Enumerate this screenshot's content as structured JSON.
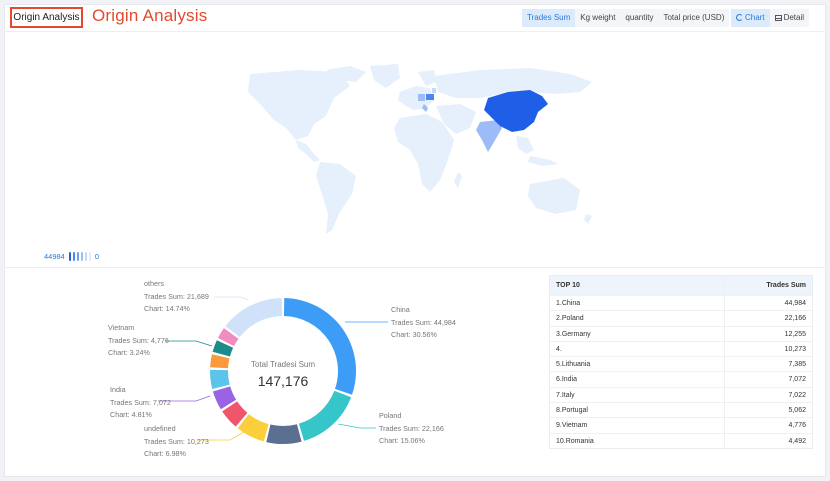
{
  "header": {
    "badge_title": "Origin Analysis",
    "big_title": "Origin Analysis",
    "metric_tabs": [
      "Trades Sum",
      "Kg weight",
      "quantity",
      "Total price (USD)"
    ],
    "active_metric": "Trades Sum",
    "view_tabs": [
      "Chart",
      "Detail"
    ],
    "active_view": "Chart"
  },
  "map_legend": {
    "max_label": "44984",
    "min_label": "0",
    "bar_colors": [
      "#1f5fe8",
      "#4d86ee",
      "#6f9ef2",
      "#9bbcf6",
      "#c4d8fa",
      "#e3edfc"
    ]
  },
  "donut": {
    "center_label": "Total Tradesi Sum",
    "center_value": "147,176",
    "labels": {
      "others": {
        "name": "others",
        "sum": "Trades Sum: 21,689",
        "pct": "Chart: 14.74%"
      },
      "vietnam": {
        "name": "Vietnam",
        "sum": "Trades Sum: 4,776",
        "pct": "Chart: 3.24%"
      },
      "india": {
        "name": "India",
        "sum": "Trades Sum: 7,072",
        "pct": "Chart: 4.81%"
      },
      "undefined": {
        "name": "undefined",
        "sum": "Trades Sum: 10,273",
        "pct": "Chart: 6.98%"
      },
      "china": {
        "name": "China",
        "sum": "Trades Sum: 44,984",
        "pct": "Chart: 30.56%"
      },
      "poland": {
        "name": "Poland",
        "sum": "Trades Sum: 22,166",
        "pct": "Chart: 15.06%"
      }
    }
  },
  "chart_data": {
    "type": "pie",
    "title": "",
    "total": 147176,
    "slices": [
      {
        "label": "China",
        "value": 44984,
        "color": "#3d9cf5"
      },
      {
        "label": "Poland",
        "value": 22166,
        "color": "#36c5c9"
      },
      {
        "label": "Germany",
        "value": 12255,
        "color": "#5b6f91"
      },
      {
        "label": "undefined",
        "value": 10273,
        "color": "#fbce3c"
      },
      {
        "label": "Lithuania",
        "value": 7385,
        "color": "#f0566b"
      },
      {
        "label": "India",
        "value": 7072,
        "color": "#9a63e3"
      },
      {
        "label": "Italy",
        "value": 7022,
        "color": "#5cc4ea"
      },
      {
        "label": "Portugal",
        "value": 5062,
        "color": "#fa9a3c"
      },
      {
        "label": "Vietnam",
        "value": 4776,
        "color": "#1a8c8a"
      },
      {
        "label": "Romania",
        "value": 4492,
        "color": "#f08cbf"
      },
      {
        "label": "others",
        "value": 21689,
        "color": "#cfe2f9"
      }
    ]
  },
  "table": {
    "col1": "TOP 10",
    "col2": "Trades Sum",
    "rows": [
      {
        "name": "1.China",
        "value": "44,984"
      },
      {
        "name": "2.Poland",
        "value": "22,166"
      },
      {
        "name": "3.Germany",
        "value": "12,255"
      },
      {
        "name": "4.",
        "value": "10,273"
      },
      {
        "name": "5.Lithuania",
        "value": "7,385"
      },
      {
        "name": "6.India",
        "value": "7,072"
      },
      {
        "name": "7.Italy",
        "value": "7,022"
      },
      {
        "name": "8.Portugal",
        "value": "5,062"
      },
      {
        "name": "9.Vietnam",
        "value": "4,776"
      },
      {
        "name": "10.Romania",
        "value": "4,492"
      }
    ]
  }
}
